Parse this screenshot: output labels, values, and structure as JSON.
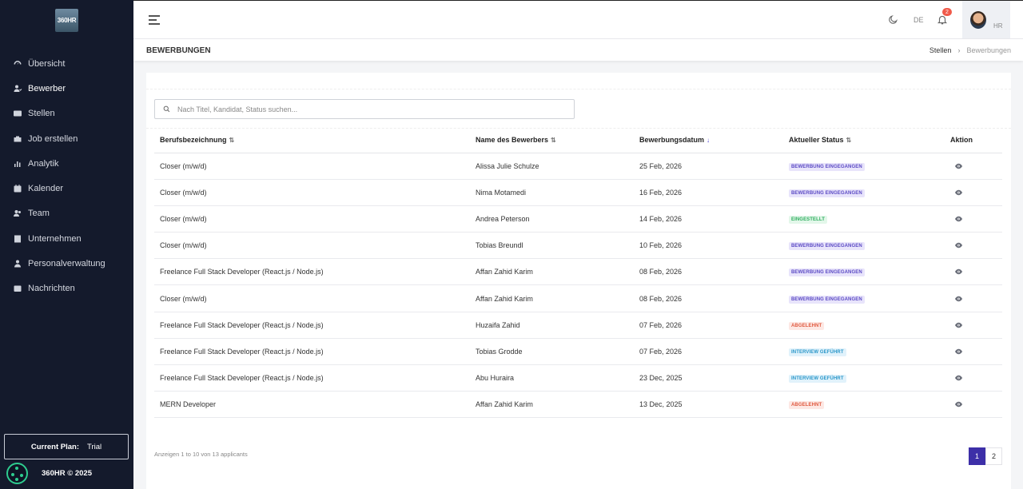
{
  "sidebar": {
    "logo_text": "360HR",
    "items": [
      {
        "label": "Übersicht",
        "icon": "dashboard-icon"
      },
      {
        "label": "Bewerber",
        "icon": "user-icon",
        "active": true
      },
      {
        "label": "Stellen",
        "icon": "id-card-icon"
      },
      {
        "label": "Job erstellen",
        "icon": "briefcase-icon"
      },
      {
        "label": "Analytik",
        "icon": "bar-chart-icon"
      },
      {
        "label": "Kalender",
        "icon": "calendar-icon"
      },
      {
        "label": "Team",
        "icon": "team-icon"
      },
      {
        "label": "Unternehmen",
        "icon": "building-icon"
      },
      {
        "label": "Personalverwaltung",
        "icon": "user-tie-icon"
      },
      {
        "label": "Nachrichten",
        "icon": "inbox-icon"
      }
    ],
    "plan_label": "Current Plan:",
    "plan_value": "Trial",
    "footer": "360HR © 2025"
  },
  "topbar": {
    "lang": "DE",
    "notification_count": "2",
    "profile_label": "HR"
  },
  "page": {
    "title": "BEWERBUNGEN",
    "breadcrumb": [
      "Stellen",
      "Bewerbungen"
    ]
  },
  "search": {
    "placeholder": "Nach Titel, Kandidat, Status suchen..."
  },
  "table": {
    "headers": [
      "Berufsbezeichnung",
      "Name des Bewerbers",
      "Bewerbungsdatum",
      "Aktueller Status",
      "Aktion"
    ],
    "rows": [
      {
        "title": "Closer (m/w/d)",
        "name": "Alissa Julie Schulze",
        "date": "25 Feb, 2026",
        "status": "BEWERBUNG EINGEGANGEN",
        "status_type": "received"
      },
      {
        "title": "Closer (m/w/d)",
        "name": "Nima Motamedi",
        "date": "16 Feb, 2026",
        "status": "BEWERBUNG EINGEGANGEN",
        "status_type": "received"
      },
      {
        "title": "Closer (m/w/d)",
        "name": "Andrea Peterson",
        "date": "14 Feb, 2026",
        "status": "EINGESTELLT",
        "status_type": "hired"
      },
      {
        "title": "Closer (m/w/d)",
        "name": "Tobias Breundl",
        "date": "10 Feb, 2026",
        "status": "BEWERBUNG EINGEGANGEN",
        "status_type": "received"
      },
      {
        "title": "Freelance Full Stack Developer (React.js / Node.js)",
        "name": "Affan Zahid Karim",
        "date": "08 Feb, 2026",
        "status": "BEWERBUNG EINGEGANGEN",
        "status_type": "received"
      },
      {
        "title": "Closer (m/w/d)",
        "name": "Affan Zahid Karim",
        "date": "08 Feb, 2026",
        "status": "BEWERBUNG EINGEGANGEN",
        "status_type": "received"
      },
      {
        "title": "Freelance Full Stack Developer (React.js / Node.js)",
        "name": "Huzaifa Zahid",
        "date": "07 Feb, 2026",
        "status": "ABGELEHNT",
        "status_type": "rejected"
      },
      {
        "title": "Freelance Full Stack Developer (React.js / Node.js)",
        "name": "Tobias Grodde",
        "date": "07 Feb, 2026",
        "status": "INTERVIEW GEFÜHRT",
        "status_type": "interview"
      },
      {
        "title": "Freelance Full Stack Developer (React.js / Node.js)",
        "name": "Abu Huraira",
        "date": "23 Dec, 2025",
        "status": "INTERVIEW GEFÜHRT",
        "status_type": "interview"
      },
      {
        "title": "MERN Developer",
        "name": "Affan Zahid Karim",
        "date": "13 Dec, 2025",
        "status": "ABGELEHNT",
        "status_type": "rejected"
      }
    ]
  },
  "pagination": {
    "info": "Anzeigen 1 to 10 von 13 applicants",
    "pages": [
      "1",
      "2"
    ],
    "current": "1"
  }
}
